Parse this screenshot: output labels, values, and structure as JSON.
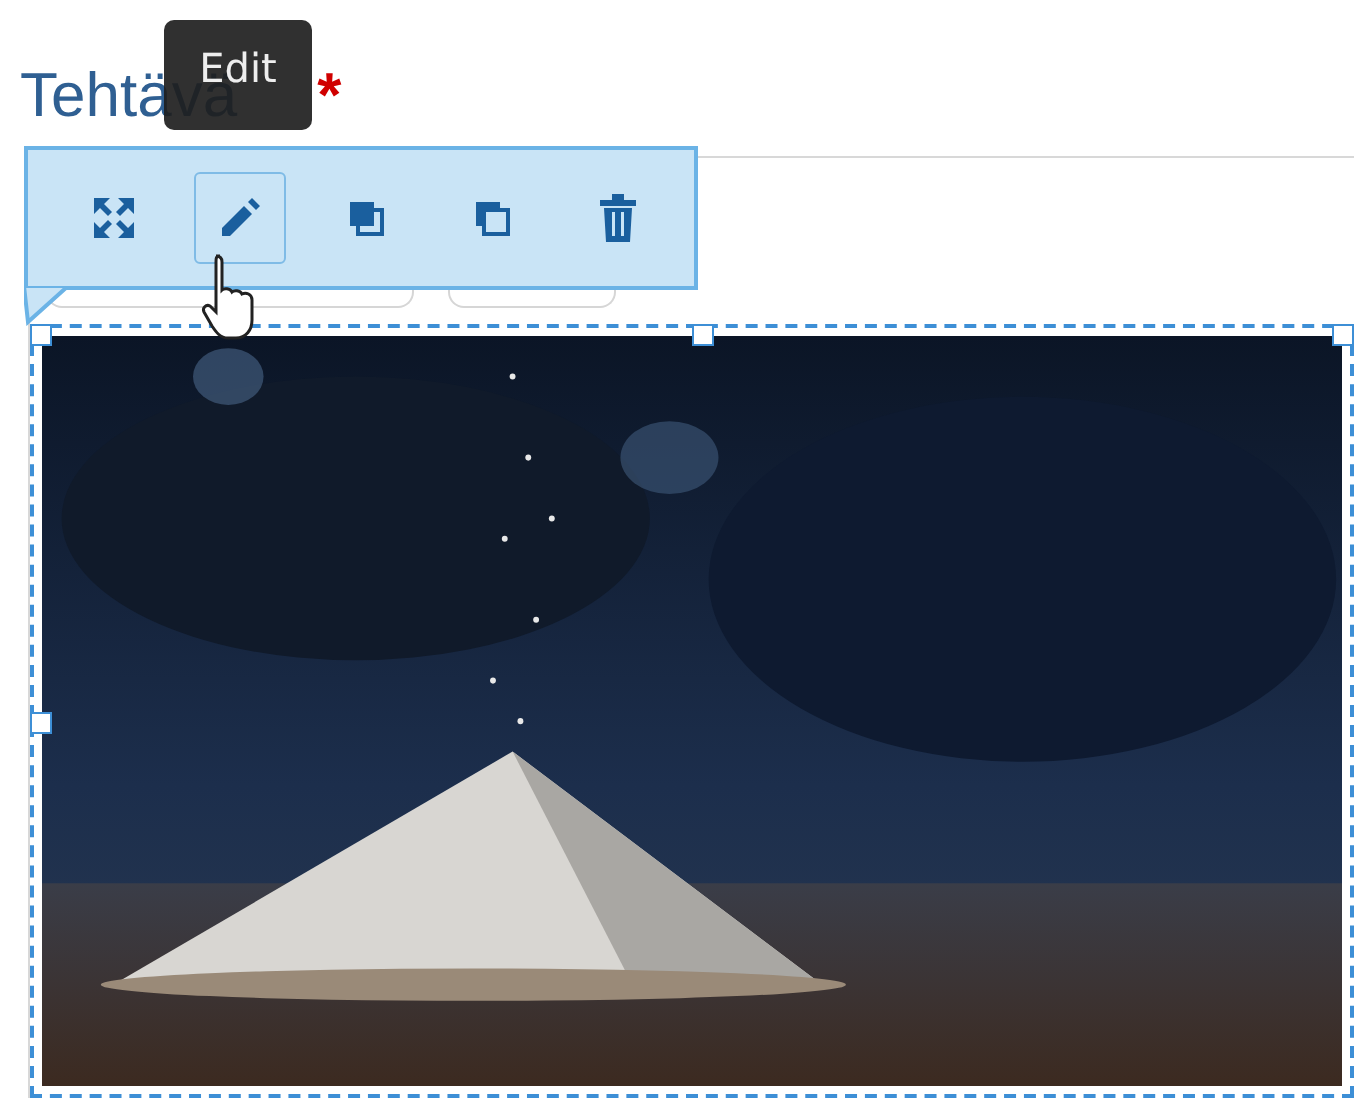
{
  "field": {
    "label": "Tehtävä",
    "required_mark": "*"
  },
  "tooltip": {
    "text": "Edit"
  },
  "toolbar": {
    "buttons": [
      {
        "kind": "resize",
        "selected": false
      },
      {
        "kind": "edit",
        "selected": true
      },
      {
        "kind": "front",
        "selected": false
      },
      {
        "kind": "back",
        "selected": false
      },
      {
        "kind": "delete",
        "selected": false
      }
    ]
  },
  "image": {
    "kind": "picture",
    "selected": true
  }
}
